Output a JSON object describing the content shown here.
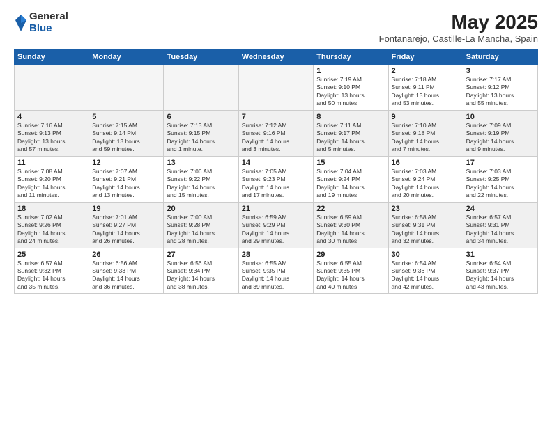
{
  "logo": {
    "general": "General",
    "blue": "Blue"
  },
  "title": "May 2025",
  "subtitle": "Fontanarejo, Castille-La Mancha, Spain",
  "headers": [
    "Sunday",
    "Monday",
    "Tuesday",
    "Wednesday",
    "Thursday",
    "Friday",
    "Saturday"
  ],
  "weeks": [
    [
      {
        "day": "",
        "info": ""
      },
      {
        "day": "",
        "info": ""
      },
      {
        "day": "",
        "info": ""
      },
      {
        "day": "",
        "info": ""
      },
      {
        "day": "1",
        "info": "Sunrise: 7:19 AM\nSunset: 9:10 PM\nDaylight: 13 hours\nand 50 minutes."
      },
      {
        "day": "2",
        "info": "Sunrise: 7:18 AM\nSunset: 9:11 PM\nDaylight: 13 hours\nand 53 minutes."
      },
      {
        "day": "3",
        "info": "Sunrise: 7:17 AM\nSunset: 9:12 PM\nDaylight: 13 hours\nand 55 minutes."
      }
    ],
    [
      {
        "day": "4",
        "info": "Sunrise: 7:16 AM\nSunset: 9:13 PM\nDaylight: 13 hours\nand 57 minutes."
      },
      {
        "day": "5",
        "info": "Sunrise: 7:15 AM\nSunset: 9:14 PM\nDaylight: 13 hours\nand 59 minutes."
      },
      {
        "day": "6",
        "info": "Sunrise: 7:13 AM\nSunset: 9:15 PM\nDaylight: 14 hours\nand 1 minute."
      },
      {
        "day": "7",
        "info": "Sunrise: 7:12 AM\nSunset: 9:16 PM\nDaylight: 14 hours\nand 3 minutes."
      },
      {
        "day": "8",
        "info": "Sunrise: 7:11 AM\nSunset: 9:17 PM\nDaylight: 14 hours\nand 5 minutes."
      },
      {
        "day": "9",
        "info": "Sunrise: 7:10 AM\nSunset: 9:18 PM\nDaylight: 14 hours\nand 7 minutes."
      },
      {
        "day": "10",
        "info": "Sunrise: 7:09 AM\nSunset: 9:19 PM\nDaylight: 14 hours\nand 9 minutes."
      }
    ],
    [
      {
        "day": "11",
        "info": "Sunrise: 7:08 AM\nSunset: 9:20 PM\nDaylight: 14 hours\nand 11 minutes."
      },
      {
        "day": "12",
        "info": "Sunrise: 7:07 AM\nSunset: 9:21 PM\nDaylight: 14 hours\nand 13 minutes."
      },
      {
        "day": "13",
        "info": "Sunrise: 7:06 AM\nSunset: 9:22 PM\nDaylight: 14 hours\nand 15 minutes."
      },
      {
        "day": "14",
        "info": "Sunrise: 7:05 AM\nSunset: 9:23 PM\nDaylight: 14 hours\nand 17 minutes."
      },
      {
        "day": "15",
        "info": "Sunrise: 7:04 AM\nSunset: 9:24 PM\nDaylight: 14 hours\nand 19 minutes."
      },
      {
        "day": "16",
        "info": "Sunrise: 7:03 AM\nSunset: 9:24 PM\nDaylight: 14 hours\nand 20 minutes."
      },
      {
        "day": "17",
        "info": "Sunrise: 7:03 AM\nSunset: 9:25 PM\nDaylight: 14 hours\nand 22 minutes."
      }
    ],
    [
      {
        "day": "18",
        "info": "Sunrise: 7:02 AM\nSunset: 9:26 PM\nDaylight: 14 hours\nand 24 minutes."
      },
      {
        "day": "19",
        "info": "Sunrise: 7:01 AM\nSunset: 9:27 PM\nDaylight: 14 hours\nand 26 minutes."
      },
      {
        "day": "20",
        "info": "Sunrise: 7:00 AM\nSunset: 9:28 PM\nDaylight: 14 hours\nand 28 minutes."
      },
      {
        "day": "21",
        "info": "Sunrise: 6:59 AM\nSunset: 9:29 PM\nDaylight: 14 hours\nand 29 minutes."
      },
      {
        "day": "22",
        "info": "Sunrise: 6:59 AM\nSunset: 9:30 PM\nDaylight: 14 hours\nand 30 minutes."
      },
      {
        "day": "23",
        "info": "Sunrise: 6:58 AM\nSunset: 9:31 PM\nDaylight: 14 hours\nand 32 minutes."
      },
      {
        "day": "24",
        "info": "Sunrise: 6:57 AM\nSunset: 9:31 PM\nDaylight: 14 hours\nand 34 minutes."
      }
    ],
    [
      {
        "day": "25",
        "info": "Sunrise: 6:57 AM\nSunset: 9:32 PM\nDaylight: 14 hours\nand 35 minutes."
      },
      {
        "day": "26",
        "info": "Sunrise: 6:56 AM\nSunset: 9:33 PM\nDaylight: 14 hours\nand 36 minutes."
      },
      {
        "day": "27",
        "info": "Sunrise: 6:56 AM\nSunset: 9:34 PM\nDaylight: 14 hours\nand 38 minutes."
      },
      {
        "day": "28",
        "info": "Sunrise: 6:55 AM\nSunset: 9:35 PM\nDaylight: 14 hours\nand 39 minutes."
      },
      {
        "day": "29",
        "info": "Sunrise: 6:55 AM\nSunset: 9:35 PM\nDaylight: 14 hours\nand 40 minutes."
      },
      {
        "day": "30",
        "info": "Sunrise: 6:54 AM\nSunset: 9:36 PM\nDaylight: 14 hours\nand 42 minutes."
      },
      {
        "day": "31",
        "info": "Sunrise: 6:54 AM\nSunset: 9:37 PM\nDaylight: 14 hours\nand 43 minutes."
      }
    ]
  ]
}
